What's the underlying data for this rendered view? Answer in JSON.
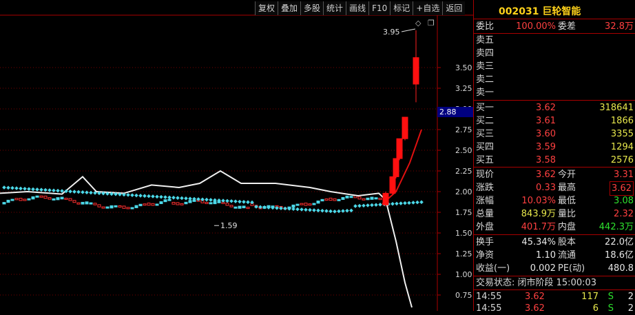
{
  "toolbar": {
    "buttons": [
      "复权",
      "叠加",
      "多股",
      "统计",
      "画线",
      "F10",
      "标记",
      "+自选",
      "返回"
    ]
  },
  "chart": {
    "y_ticks": [
      "3.50",
      "3.25",
      "3.00",
      "2.75",
      "2.50",
      "2.25",
      "2.00",
      "1.75",
      "1.50",
      "1.25",
      "1.00",
      "0.75"
    ],
    "high_label": "3.95",
    "low_label": "1.59",
    "current_price_tag": "2.88",
    "diamond_icon": "◇",
    "restore_icon": "❐"
  },
  "chart_data": {
    "type": "candlestick",
    "ylim": [
      0.6,
      3.95
    ],
    "y_ticks": [
      3.5,
      3.25,
      3.0,
      2.75,
      2.5,
      2.25,
      2.0,
      1.75,
      1.5,
      1.25,
      1.0,
      0.75
    ],
    "annotations": [
      {
        "text": "3.95",
        "value": 3.95
      },
      {
        "text": "1.59",
        "value": 1.59
      }
    ],
    "recent_candles": [
      {
        "open": 1.84,
        "close": 1.98,
        "high": 2.0,
        "low": 1.82
      },
      {
        "open": 1.98,
        "close": 2.18,
        "high": 2.18,
        "low": 1.96
      },
      {
        "open": 2.18,
        "close": 2.4,
        "high": 2.4,
        "low": 2.16
      },
      {
        "open": 2.4,
        "close": 2.64,
        "high": 2.64,
        "low": 2.38
      },
      {
        "open": 2.64,
        "close": 2.9,
        "high": 2.9,
        "low": 2.62
      },
      {
        "open": 3.3,
        "close": 3.62,
        "high": 3.95,
        "low": 3.08
      }
    ],
    "current_price": 2.88
  },
  "panel": {
    "code_title": "002031 巨轮智能",
    "weibi": {
      "label": "委比",
      "value": "100.00%",
      "label2": "委差",
      "value2": "32.8万"
    },
    "sells": [
      {
        "label": "卖五"
      },
      {
        "label": "卖四"
      },
      {
        "label": "卖三"
      },
      {
        "label": "卖二"
      },
      {
        "label": "卖一"
      }
    ],
    "buys": [
      {
        "label": "买一",
        "price": "3.62",
        "vol": "318641"
      },
      {
        "label": "买二",
        "price": "3.61",
        "vol": "1866"
      },
      {
        "label": "买三",
        "price": "3.60",
        "vol": "3355"
      },
      {
        "label": "买四",
        "price": "3.59",
        "vol": "1294"
      },
      {
        "label": "买五",
        "price": "3.58",
        "vol": "2576"
      }
    ],
    "quote": [
      {
        "l1": "现价",
        "v1": "3.62",
        "l2": "今开",
        "v2": "3.31"
      },
      {
        "l1": "涨跌",
        "v1": "0.33",
        "l2": "最高",
        "v2": "3.62"
      },
      {
        "l1": "涨幅",
        "v1": "10.03%",
        "l2": "最低",
        "v2": "3.08"
      },
      {
        "l1": "总量",
        "v1": "843.9万",
        "l2": "量比",
        "v2": "2.32"
      },
      {
        "l1": "外盘",
        "v1": "401.7万",
        "l2": "内盘",
        "v2": "442.3万"
      }
    ],
    "fund": [
      {
        "l1": "换手",
        "v1": "45.34%",
        "l2": "股本",
        "v2": "22.0亿"
      },
      {
        "l1": "净资",
        "v1": "1.10",
        "l2": "流通",
        "v2": "18.6亿"
      },
      {
        "l1": "收益(一)",
        "v1": "0.002",
        "l2": "PE(动)",
        "v2": "480.8"
      }
    ],
    "status": "交易状态: 闭市阶段 15:00:03",
    "ticks": [
      {
        "time": "14:55",
        "price": "3.62",
        "vol": "117",
        "flag": "S",
        "n": "2"
      },
      {
        "time": "14:55",
        "price": "3.62",
        "vol": "6",
        "flag": "S",
        "n": "2"
      }
    ]
  }
}
